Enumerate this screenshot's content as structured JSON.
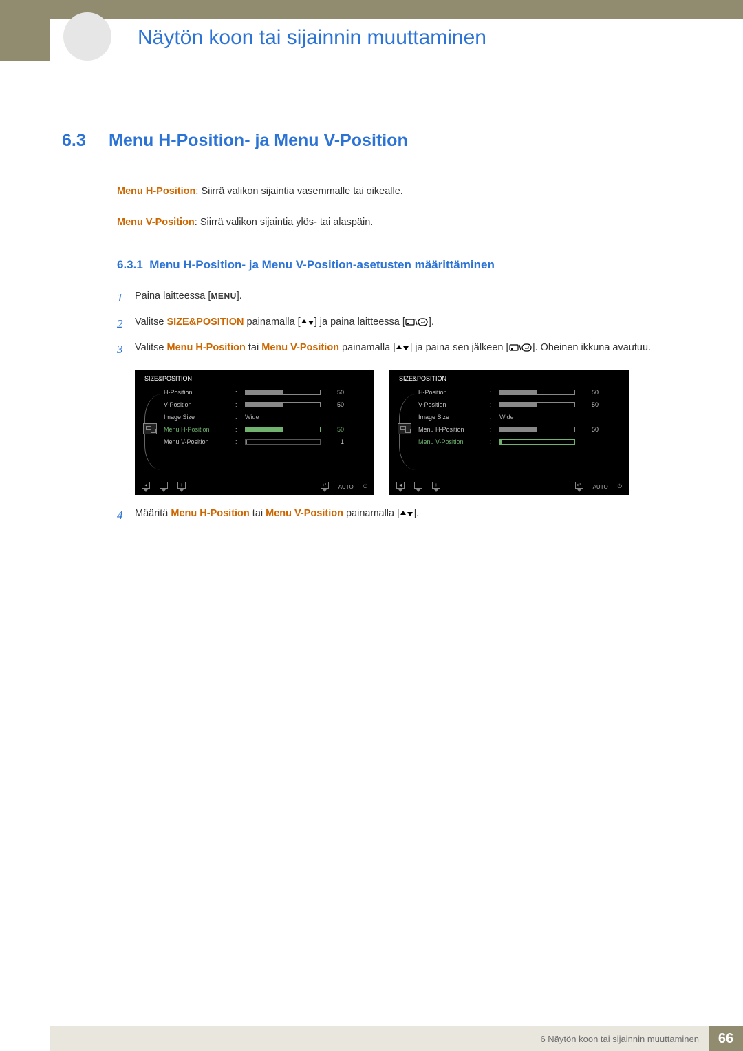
{
  "chapter_title": "Näytön koon tai sijainnin muuttaminen",
  "section": {
    "number": "6.3",
    "title": "Menu H-Position- ja Menu V-Position"
  },
  "definitions": {
    "h_label": "Menu H-Position",
    "h_text": ": Siirrä valikon sijaintia vasemmalle tai oikealle.",
    "v_label": "Menu V-Position",
    "v_text": ": Siirrä valikon sijaintia ylös- tai alaspäin."
  },
  "subsection": {
    "number": "6.3.1",
    "title": "Menu H-Position- ja Menu V-Position-asetusten määrittäminen"
  },
  "steps": {
    "s1": {
      "pre": "Paina laitteessa [",
      "menu": "MENU",
      "post": "]."
    },
    "s2": {
      "pre": "Valitse ",
      "hl": "SIZE&POSITION",
      "mid": " painamalla [",
      "post1": "] ja paina laitteessa [",
      "post2": "]."
    },
    "s3": {
      "pre": "Valitse ",
      "hl1": "Menu H-Position",
      "mid1": " tai ",
      "hl2": "Menu V-Position",
      "mid2": " painamalla [",
      "post1": "] ja paina sen jälkeen [",
      "post2": "]. Oheinen ikkuna avautuu."
    },
    "s4": {
      "pre": "Määritä ",
      "hl1": "Menu H-Position",
      "mid1": " tai ",
      "hl2": "Menu V-Position",
      "mid2": " painamalla [",
      "post": "]."
    }
  },
  "osd_left": {
    "title": "SIZE&POSITION",
    "rows": [
      {
        "label": "H-Position",
        "value": "50",
        "fill": 50,
        "highlight": false
      },
      {
        "label": "V-Position",
        "value": "50",
        "fill": 50,
        "highlight": false
      },
      {
        "label": "Image Size",
        "text": "Wide"
      },
      {
        "label": "Menu H-Position",
        "value": "50",
        "fill": 50,
        "highlight": true
      },
      {
        "label": "Menu V-Position",
        "value": "1",
        "fill": 2,
        "highlight": false,
        "dim": true
      }
    ],
    "footer_auto": "AUTO"
  },
  "osd_right": {
    "title": "SIZE&POSITION",
    "rows": [
      {
        "label": "H-Position",
        "value": "50",
        "fill": 50,
        "highlight": false
      },
      {
        "label": "V-Position",
        "value": "50",
        "fill": 50,
        "highlight": false
      },
      {
        "label": "Image Size",
        "text": "Wide"
      },
      {
        "label": "Menu H-Position",
        "value": "50",
        "fill": 50,
        "highlight": false
      },
      {
        "label": "Menu V-Position",
        "value": "",
        "fill": 2,
        "highlight": true
      }
    ],
    "footer_auto": "AUTO"
  },
  "footer": {
    "chapter_ref": "6 Näytön koon tai sijainnin muuttaminen",
    "page": "66"
  }
}
